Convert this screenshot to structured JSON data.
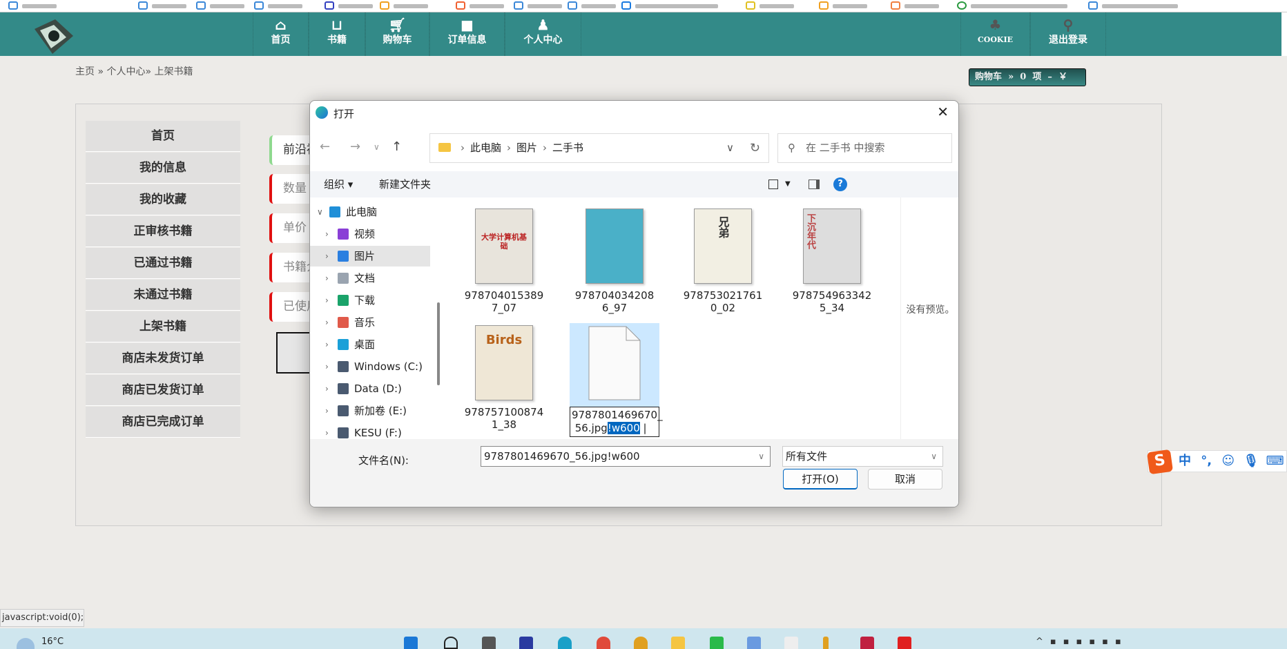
{
  "navbar": {
    "items": [
      {
        "label": "首页",
        "icon": "home-icon"
      },
      {
        "label": "书籍",
        "icon": "basket-icon"
      },
      {
        "label": "购物车",
        "icon": "cart-icon"
      },
      {
        "label": "订单信息",
        "icon": "truck-icon"
      },
      {
        "label": "个人中心",
        "icon": "user-add-icon"
      }
    ],
    "right": [
      {
        "label": "COOKIE",
        "icon": "cookie-icon"
      },
      {
        "label": "退出登录",
        "icon": "pin-icon"
      }
    ]
  },
  "breadcrumb": "主页 » 个人中心» 上架书籍",
  "cart": {
    "label": "购物车",
    "summary": "»  0  项  –  ￥"
  },
  "sidebar": [
    "首页",
    "我的信息",
    "我的收藏",
    "正审核书籍",
    "已通过书籍",
    "未通过书籍",
    "上架书籍",
    "商店未发货订单",
    "商店已发货订单",
    "商店已完成订单"
  ],
  "form": {
    "fields": [
      "前沿福",
      "数量",
      "单价",
      "书籍介",
      "已使用"
    ]
  },
  "dialog": {
    "title": "打开",
    "path": [
      "此电脑",
      "图片",
      "二手书"
    ],
    "search_placeholder": "在 二手书 中搜索",
    "organize": "组织 ▾",
    "new_folder": "新建文件夹",
    "tree": [
      {
        "label": "此电脑",
        "color": "#1f8fd8",
        "expanded": true
      },
      {
        "label": "视频",
        "color": "#8a3fd6"
      },
      {
        "label": "图片",
        "color": "#2a7fe0"
      },
      {
        "label": "文档",
        "color": "#9aa4b0"
      },
      {
        "label": "下载",
        "color": "#1aa36a"
      },
      {
        "label": "音乐",
        "color": "#e05a4a"
      },
      {
        "label": "桌面",
        "color": "#1aa0d8"
      },
      {
        "label": "Windows (C:)",
        "color": "#4a5a70"
      },
      {
        "label": "Data (D:)",
        "color": "#4a5a70"
      },
      {
        "label": "新加卷 (E:)",
        "color": "#4a5a70"
      },
      {
        "label": "KESU (F:)",
        "color": "#4a5a70"
      }
    ],
    "files": [
      {
        "name": "9787040153897_07",
        "cover": "#e8e4dc",
        "title": "大学计算机基础"
      },
      {
        "name": "9787040342086_97",
        "cover": "#4ab0c8",
        "title": ""
      },
      {
        "name": "9787530217610_02",
        "cover": "#f2efe3",
        "title": "兄弟"
      },
      {
        "name": "9787549633425_34",
        "cover": "#ddd",
        "title": "下沉年代"
      },
      {
        "name": "9787571008741_38",
        "cover": "#efe7d6",
        "title": "Birds"
      }
    ],
    "editing_file": {
      "prefix": "9787801469670_56.jpg",
      "selected": "!w600"
    },
    "no_preview": "没有预览。",
    "filename_label": "文件名(N):",
    "filename_value": "9787801469670_56.jpg!w600",
    "filetype": "所有文件",
    "open_button": "打开(O)",
    "cancel_button": "取消"
  },
  "status_text": "javascript:void(0);",
  "taskbar": {
    "weather": "16°C"
  },
  "ime": {
    "mode": "中",
    "punct": "°,"
  }
}
